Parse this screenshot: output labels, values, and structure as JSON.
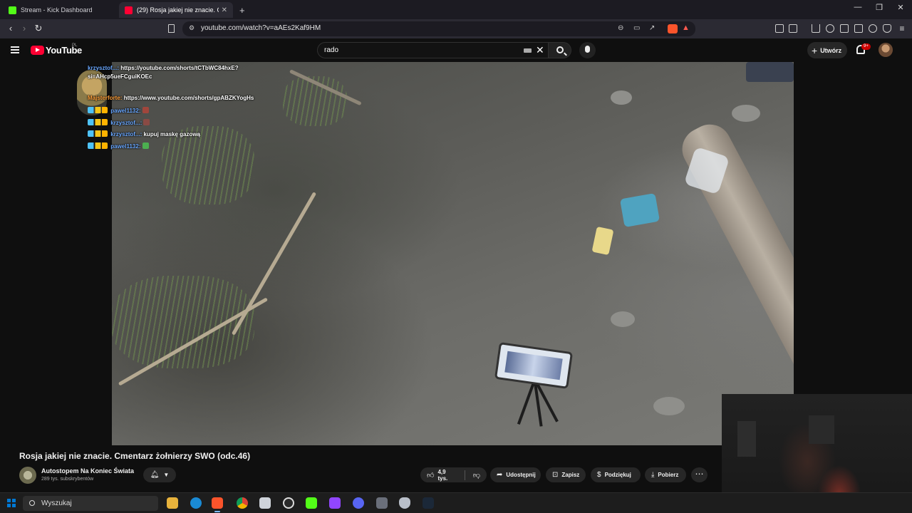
{
  "browser": {
    "tabs": [
      {
        "title": "Stream - Kick Dashboard",
        "favicon": "kick-icon",
        "color": "#53fc18"
      },
      {
        "title": "(29) Rosja jakiej nie znacie. Cm",
        "favicon": "youtube-icon",
        "color": "#ff0033",
        "active": true
      }
    ],
    "new_tab": "+",
    "url": "youtube.com/watch?v=aAEs2Kaf9HM"
  },
  "youtube": {
    "logo_text": "YouTube",
    "region": "PL",
    "search_value": "rado",
    "create_label": "Utwórz",
    "notifications_badge": "9+"
  },
  "chat": [
    {
      "user": "krzysztof...:",
      "message": "https://youtube.com/shorts/tCTbWC84hxE?"
    },
    {
      "user": "",
      "message": "si=AHcp5ueFCguiKOEc"
    },
    {
      "user": "Majsterforte:",
      "message": "https://www.youtube.com/shorts/gpABZKYogHs"
    },
    {
      "user": "pawel1132:",
      "message": ""
    },
    {
      "user": "krzysztof...:",
      "message": ""
    },
    {
      "user": "krzysztof...:",
      "message": "kupuj maskę gazową"
    },
    {
      "user": "pawel1132:",
      "message": ""
    }
  ],
  "video": {
    "title": "Rosja jakiej nie znacie. Cmentarz żołnierzy SWO (odc.46)",
    "channel": "Autostopem Na Koniec Świata",
    "subscribers": "289 tys. subskrybentów",
    "likes": "4,9 tys.",
    "actions": {
      "share": "Udostępnij",
      "save": "Zapisz",
      "thanks": "Podziękuj",
      "download": "Pobierz"
    }
  },
  "taskbar": {
    "search_label": "Wyszukaj"
  }
}
